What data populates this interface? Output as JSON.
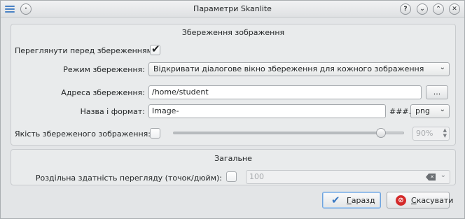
{
  "window": {
    "title": "Параметри Skanlite",
    "buttons": [
      "?",
      "⌄",
      "⌃",
      "✕"
    ]
  },
  "save_group": {
    "title": "Збереження зображення",
    "preview_label": "Переглянути перед збереженням:",
    "preview_checked": true,
    "mode_label": "Режим збереження:",
    "mode_value": "Відкривати діалогове вікно збереження для кожного зображення",
    "address_label": "Адреса збереження:",
    "address_value": "/home/student",
    "browse_label": "...",
    "name_label": "Назва і формат:",
    "name_value": "Image-",
    "number_mask": "###.",
    "format_value": "png",
    "quality_label": "Якість збереженого зображення:",
    "quality_checked": false,
    "quality_value": "90%",
    "quality_fraction": 0.9
  },
  "general_group": {
    "title": "Загальне",
    "resolution_label": "Роздільна здатність перегляду (точок/дюйм):",
    "resolution_checked": false,
    "resolution_value": "100"
  },
  "dialog_buttons": {
    "ok_label": "Гаразд",
    "ok_mnemonic": "Г",
    "ok_rest": "аразд",
    "cancel_label": "Скасувати",
    "cancel_mnemonic": "С",
    "cancel_rest": "касувати"
  },
  "colors": {
    "accent": "#3a78c2",
    "cancel_red": "#d42a2a"
  }
}
